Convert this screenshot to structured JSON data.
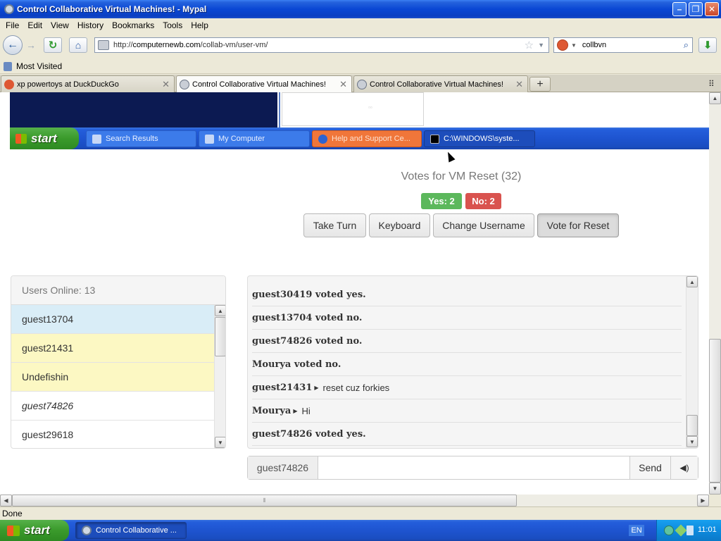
{
  "window": {
    "title": "Control Collaborative Virtual Machines! - Mypal"
  },
  "menu": [
    "File",
    "Edit",
    "View",
    "History",
    "Bookmarks",
    "Tools",
    "Help"
  ],
  "nav": {
    "url_prefix": "http://",
    "url_host": "computernewb.com",
    "url_path": "/collab-vm/user-vm/",
    "search_query": "collbvn"
  },
  "bookmarks": {
    "most_visited": "Most Visited"
  },
  "tabs": [
    {
      "label": "xp powertoys at DuckDuckGo",
      "active": false
    },
    {
      "label": "Control Collaborative Virtual Machines!",
      "active": true
    },
    {
      "label": "Control Collaborative Virtual Machines!",
      "active": false
    }
  ],
  "vm": {
    "start_label": "start",
    "taskbar_items": [
      {
        "label": "Search Results"
      },
      {
        "label": "My Computer"
      },
      {
        "label": "Help and Support Ce..."
      },
      {
        "label": "C:\\WINDOWS\\syste..."
      }
    ]
  },
  "vote": {
    "title": "Votes for VM Reset (32)",
    "yes": "Yes: 2",
    "no": "No: 2"
  },
  "actions": {
    "take_turn": "Take Turn",
    "keyboard": "Keyboard",
    "change_username": "Change Username",
    "vote_reset": "Vote for Reset"
  },
  "users": {
    "header": "Users Online: 13",
    "list": [
      {
        "name": "guest13704",
        "style": "blue"
      },
      {
        "name": "guest21431",
        "style": "yellow"
      },
      {
        "name": "Undefishin",
        "style": "yellow"
      },
      {
        "name": "guest74826",
        "style": "italic"
      },
      {
        "name": "guest29618",
        "style": "plain"
      }
    ]
  },
  "chat": {
    "messages": [
      {
        "who": "guest30419 voted yes.",
        "msg": ""
      },
      {
        "who": "guest13704 voted no.",
        "msg": ""
      },
      {
        "who": "guest74826 voted no.",
        "msg": ""
      },
      {
        "who": "Mourya voted no.",
        "msg": ""
      },
      {
        "who": "guest21431",
        "msg": "reset cuz forkies"
      },
      {
        "who": "Mourya",
        "msg": "Hi"
      },
      {
        "who": "guest74826 voted yes.",
        "msg": ""
      }
    ],
    "username": "guest74826",
    "send": "Send"
  },
  "status": {
    "text": "Done"
  },
  "host_taskbar": {
    "start_label": "start",
    "task_label": "Control Collaborative ...",
    "lang": "EN",
    "clock": "11:01"
  }
}
